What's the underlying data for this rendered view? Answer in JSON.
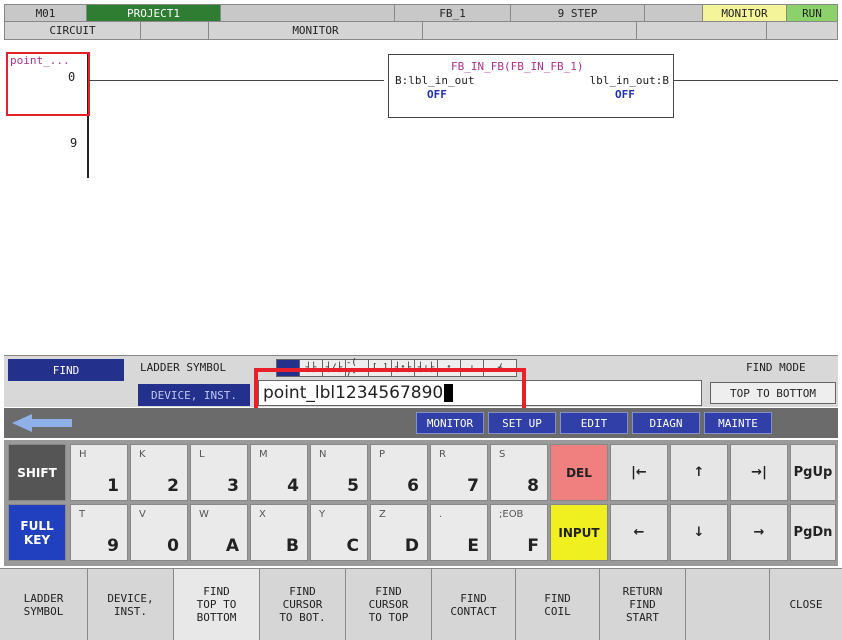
{
  "status_bar": {
    "cells": [
      "M01",
      "PROJECT1",
      "",
      "FB_1",
      "9 STEP",
      "",
      "MONITOR",
      "RUN"
    ],
    "colors": {
      "project": "#2e7d32",
      "monitor": "#f4f49a",
      "run": "#8bd26b"
    }
  },
  "view_bar": {
    "cells": [
      "CIRCUIT",
      "",
      "MONITOR",
      "",
      "",
      ""
    ]
  },
  "ladder": {
    "label": "point_...",
    "step0": "0",
    "step9": "9",
    "fb": {
      "title": "FB_IN_FB(FB_IN_FB_1)",
      "left_pin": "B:lbl_in_out",
      "right_pin": "lbl_in_out:B",
      "left_state": "OFF",
      "right_state": "OFF"
    }
  },
  "find": {
    "label": "FIND",
    "ladder_symbol": "LADDER SYMBOL",
    "device_inst": "DEVICE, INST.",
    "input_value": "point_lbl1234567890",
    "find_mode_label": "FIND MODE",
    "find_mode_value": "TOP TO BOTTOM",
    "symbols": [
      "",
      "┤├",
      "┤/├",
      "-( )-",
      "[ ]",
      "┤↑├",
      "┤↓├",
      "↑",
      "↓",
      "⌿"
    ]
  },
  "mode_tabs": [
    "MONITOR",
    "SET UP",
    "EDIT",
    "DIAGN",
    "MAINTE"
  ],
  "keypad": {
    "shift": "SHIFT",
    "full_key": "FULL KEY",
    "row1": [
      {
        "sub": "H",
        "main": "1"
      },
      {
        "sub": "K",
        "main": "2"
      },
      {
        "sub": "L",
        "main": "3"
      },
      {
        "sub": "M",
        "main": "4"
      },
      {
        "sub": "N",
        "main": "5"
      },
      {
        "sub": "P",
        "main": "6"
      },
      {
        "sub": "R",
        "main": "7"
      },
      {
        "sub": "S",
        "main": "8"
      }
    ],
    "row2": [
      {
        "sub": "T",
        "main": "9"
      },
      {
        "sub": "V",
        "main": "0"
      },
      {
        "sub": "W",
        "main": "A"
      },
      {
        "sub": "X",
        "main": "B"
      },
      {
        "sub": "Y",
        "main": "C"
      },
      {
        "sub": "Z",
        "main": "D"
      },
      {
        "sub": ".",
        "main": "E"
      },
      {
        "sub": ";EOB",
        "main": "F"
      }
    ],
    "del": "DEL",
    "input": "INPUT",
    "nav_row1": [
      "|←",
      "↑",
      "→|",
      "PgUp"
    ],
    "nav_row2": [
      "←",
      "↓",
      "→",
      "PgDn"
    ]
  },
  "function_keys": [
    "LADDER\nSYMBOL",
    "DEVICE,\nINST.",
    "FIND\nTOP TO\nBOTTOM",
    "FIND\nCURSOR\nTO BOT.",
    "FIND\nCURSOR\nTO TOP",
    "FIND\nCONTACT",
    "FIND\nCOIL",
    "RETURN\nFIND\nSTART",
    "",
    "CLOSE"
  ]
}
